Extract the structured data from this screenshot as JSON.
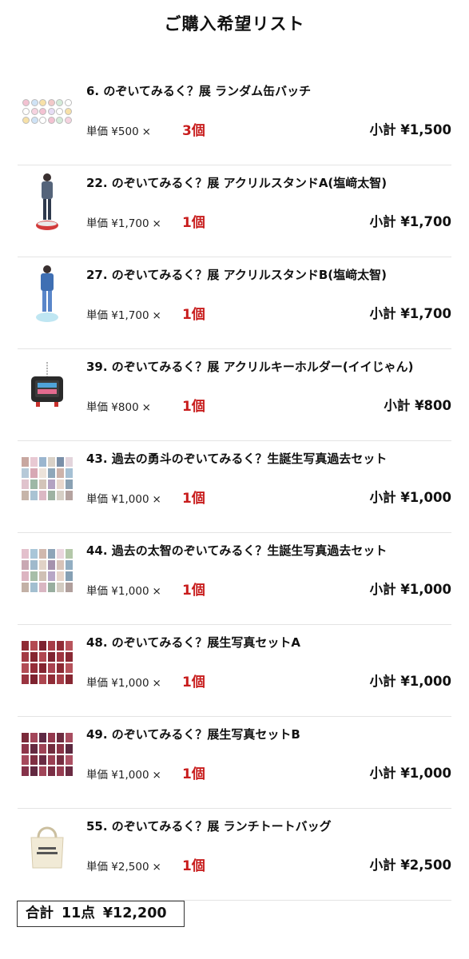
{
  "header": {
    "title": "ご購入希望リスト"
  },
  "labels": {
    "unit_price": "単価",
    "times": "×",
    "subtotal": "小計"
  },
  "items": [
    {
      "name": "6. のぞいてみるく？展 ランダム缶バッチ",
      "unit_price": "¥500",
      "qty": "3個",
      "subtotal": "¥1,500",
      "thumb_icon": "badge-set-icon"
    },
    {
      "name": "22. のぞいてみるく？展 アクリルスタンドA(塩﨑太智)",
      "unit_price": "¥1,700",
      "qty": "1個",
      "subtotal": "¥1,700",
      "thumb_icon": "acrylic-stand-icon"
    },
    {
      "name": "27. のぞいてみるく？展 アクリルスタンドB(塩﨑太智)",
      "unit_price": "¥1,700",
      "qty": "1個",
      "subtotal": "¥1,700",
      "thumb_icon": "acrylic-stand-icon"
    },
    {
      "name": "39. のぞいてみるく？展 アクリルキーホルダー(イイじゃん)",
      "unit_price": "¥800",
      "qty": "1個",
      "subtotal": "¥800",
      "thumb_icon": "tv-keychain-icon"
    },
    {
      "name": "43. 過去の勇斗のぞいてみるく？生誕生写真過去セット",
      "unit_price": "¥1,000",
      "qty": "1個",
      "subtotal": "¥1,000",
      "thumb_icon": "photo-set-icon"
    },
    {
      "name": "44. 過去の太智のぞいてみるく？生誕生写真過去セット",
      "unit_price": "¥1,000",
      "qty": "1個",
      "subtotal": "¥1,000",
      "thumb_icon": "photo-set-icon"
    },
    {
      "name": "48. のぞいてみるく？展生写真セットA",
      "unit_price": "¥1,000",
      "qty": "1個",
      "subtotal": "¥1,000",
      "thumb_icon": "photo-grid-icon"
    },
    {
      "name": "49. のぞいてみるく？展生写真セットB",
      "unit_price": "¥1,000",
      "qty": "1個",
      "subtotal": "¥1,000",
      "thumb_icon": "photo-grid-icon"
    },
    {
      "name": "55. のぞいてみるく？展 ランチトートバッグ",
      "unit_price": "¥2,500",
      "qty": "1個",
      "subtotal": "¥2,500",
      "thumb_icon": "tote-bag-icon"
    }
  ],
  "total": {
    "label": "合計",
    "count": "11点",
    "amount": "¥12,200"
  },
  "colors": {
    "quantity": "#c81d1d",
    "divider": "#e4e4e4",
    "text": "#111111"
  }
}
